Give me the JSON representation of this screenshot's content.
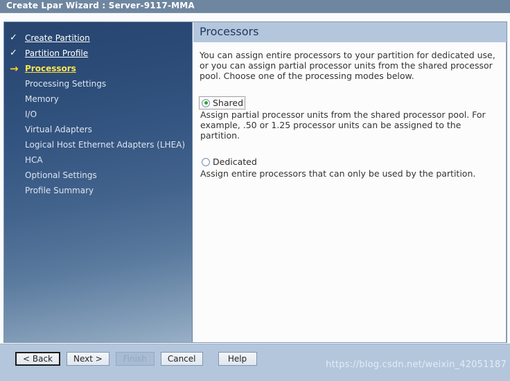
{
  "window": {
    "title": "Create Lpar Wizard : Server-9117-MMA"
  },
  "sidebar": {
    "items": [
      {
        "label": "Create Partition",
        "state": "done",
        "marker": "check-icon"
      },
      {
        "label": "Partition Profile",
        "state": "done",
        "marker": "check-icon"
      },
      {
        "label": "Processors",
        "state": "current",
        "marker": "arrow-right-icon"
      },
      {
        "label": "Processing Settings",
        "state": "pending",
        "marker": ""
      },
      {
        "label": "Memory",
        "state": "pending",
        "marker": ""
      },
      {
        "label": "I/O",
        "state": "pending",
        "marker": ""
      },
      {
        "label": "Virtual Adapters",
        "state": "pending",
        "marker": ""
      },
      {
        "label": "Logical Host Ethernet Adapters (LHEA)",
        "state": "pending",
        "marker": ""
      },
      {
        "label": "HCA",
        "state": "pending",
        "marker": ""
      },
      {
        "label": "Optional Settings",
        "state": "pending",
        "marker": ""
      },
      {
        "label": "Profile Summary",
        "state": "pending",
        "marker": ""
      }
    ]
  },
  "content": {
    "header": "Processors",
    "intro": "You can assign entire processors to your partition for dedicated use, or you can assign partial processor units from the shared processor pool. Choose one of the processing modes below.",
    "options": [
      {
        "label": "Shared",
        "selected": true,
        "focused": true,
        "description": "Assign partial processor units from the shared processor pool. For example, .50 or 1.25 processor units can be assigned to the partition."
      },
      {
        "label": "Dedicated",
        "selected": false,
        "focused": false,
        "description": "Assign entire processors that can only be used by the partition."
      }
    ]
  },
  "footer": {
    "buttons": [
      {
        "label": "< Back",
        "state": "default"
      },
      {
        "label": "Next >",
        "state": "normal"
      },
      {
        "label": "Finish",
        "state": "disabled"
      },
      {
        "label": "Cancel",
        "state": "normal"
      },
      {
        "label": "Help",
        "state": "normal"
      }
    ]
  },
  "watermark": {
    "text": "https://blog.csdn.net/weixin_42051187"
  },
  "colors": {
    "titlebar": "#6f86a0",
    "sidebar_top": "#27456f",
    "sidebar_bottom": "#98afc6",
    "header_band": "#b4c6dc",
    "current_item": "#ffe34d",
    "arrow": "#ffd21e",
    "radio_dot": "#2ba52b",
    "header_text": "#1f3864"
  }
}
